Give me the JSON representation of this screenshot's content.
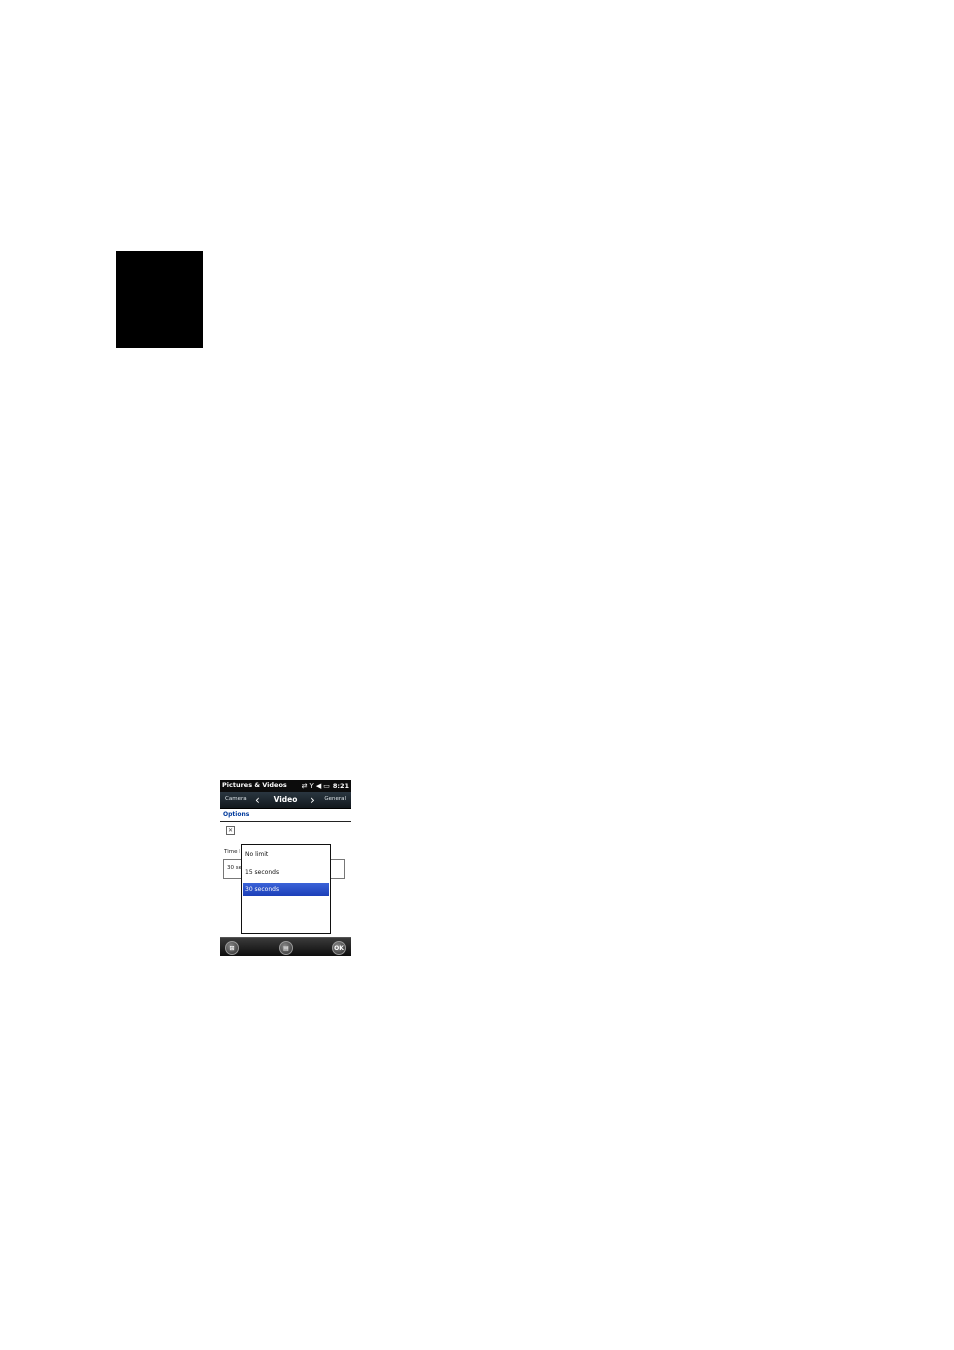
{
  "app_title": "Pictures & Videos",
  "status_bar": {
    "time": "8:21",
    "icons": [
      "sync-icon",
      "signal-icon",
      "volume-icon",
      "battery-icon"
    ]
  },
  "nav": {
    "prev_tab": "Camera",
    "current_tab": "Video",
    "next_tab": "General"
  },
  "section_label": "Options",
  "checkbox_mark": "✕",
  "time_limit_label": "Time limit",
  "time_limit_value": "30 seconds",
  "dropdown_options": [
    "No limit",
    "15 seconds",
    "30 seconds"
  ],
  "selected_option": "30 seconds",
  "bottom_bar": {
    "ok_label": "OK"
  },
  "colors": {
    "selection": "#2a4fc9",
    "section_label": "#003a9c"
  }
}
